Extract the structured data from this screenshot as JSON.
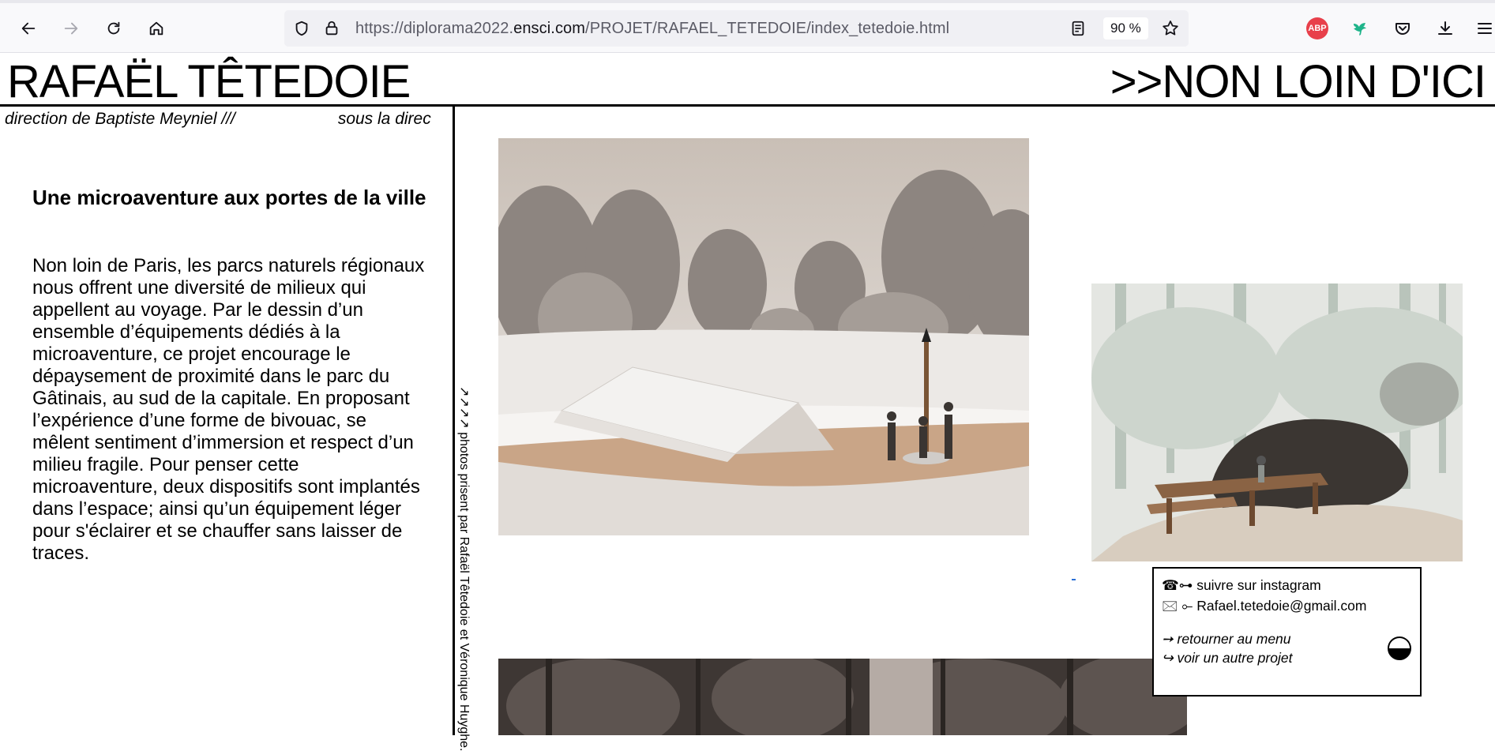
{
  "browser": {
    "url_prefix": "https://diplorama2022.",
    "url_domain": "ensci.com",
    "url_path": "/PROJET/RAFAEL_TETEDOIE/index_tetedoie.html",
    "zoom": "90 %",
    "extension_abp_label": "ABP",
    "icons": [
      "back-icon",
      "forward-icon",
      "reload-icon",
      "home-icon",
      "shield-icon",
      "lock-icon",
      "reader-view-icon",
      "bookmark-star-icon",
      "adblock-icon",
      "extension-bird-icon",
      "pocket-icon",
      "downloads-icon",
      "menu-icon"
    ]
  },
  "page": {
    "site_title": "RAFAËL TÊTEDOIE",
    "project_title": ">>NON LOIN D'ICI",
    "marquee_left": "direction de Baptiste Meyniel  ///",
    "marquee_right": "sous la direc",
    "article_title": "Une microaventure aux portes de la ville",
    "article_body": "Non loin de Paris, les parcs naturels régionaux nous offrent une diversité de milieux qui appellent au voyage. Par le dessin d’un ensemble d’équipements dédiés à la microaventure, ce projet encourage le dépaysement de proximité dans le parc du Gâtinais, au sud de la capitale. En proposant l’expérience d’une forme de bivouac, se mêlent sentiment d’immersion et respect d’un milieu fragile. Pour penser cette microaventure, deux dispositifs sont implantés dans l’espace; ainsi qu’un équipement léger pour s'éclairer et se chauffer sans laisser de traces.",
    "vertical_credit": "↗↗↗↗ photos prisent par Rafaël Têtedoie et Véronique Huyghe.",
    "contact": {
      "instagram_icon": "☎︎⊶",
      "instagram_label": "suivre sur instagram",
      "email_icon": "🖂 ⟜",
      "email_label": "Rafael.tetedoie@gmail.com",
      "menu_icon": "➙",
      "menu_label": "retourner au menu",
      "other_icon": "↪",
      "other_label": "voir un autre projet"
    },
    "colors": {
      "text": "#000000",
      "background": "#ffffff",
      "chrome_bg": "#f9f9fb",
      "urlbar_bg": "#f0f0f4",
      "abp_red": "#e8404b",
      "extension_green": "#1fb48a"
    }
  }
}
